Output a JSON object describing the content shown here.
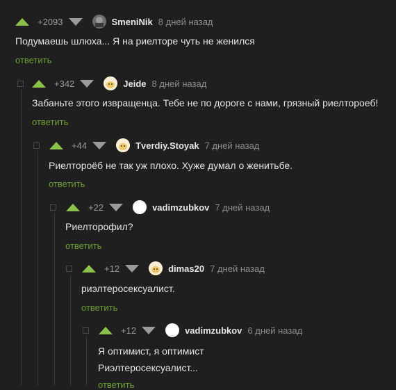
{
  "comments": [
    {
      "rating": "+2093",
      "username": "SmeniNik",
      "time": "8 дней назад",
      "text": "Подумаешь шлюха... Я на риелторе чуть не женился",
      "reply": "ответить"
    },
    {
      "rating": "+342",
      "username": "Jeide",
      "time": "8 дней назад",
      "text": "Забаньте этого извращенца. Тебе не по дороге с нами, грязный риелтороеб!",
      "reply": "ответить"
    },
    {
      "rating": "+44",
      "username": "Tverdiy.Stoyak",
      "time": "7 дней назад",
      "text": "Риелтороёб не так уж плохо. Хуже думал о женитьбе.",
      "reply": "ответить"
    },
    {
      "rating": "+22",
      "username": "vadimzubkov",
      "time": "7 дней назад",
      "text": "Риелторофил?",
      "reply": "ответить"
    },
    {
      "rating": "+12",
      "username": "dimas20",
      "time": "7 дней назад",
      "text": "риэлтеросексуалист.",
      "reply": "ответить"
    },
    {
      "rating": "+12",
      "username": "vadimzubkov",
      "time": "6 дней назад",
      "text_line1": "Я оптимист, я оптимист",
      "text_line2": "Риэлтеросексуалист...",
      "reply": "ответить"
    }
  ]
}
